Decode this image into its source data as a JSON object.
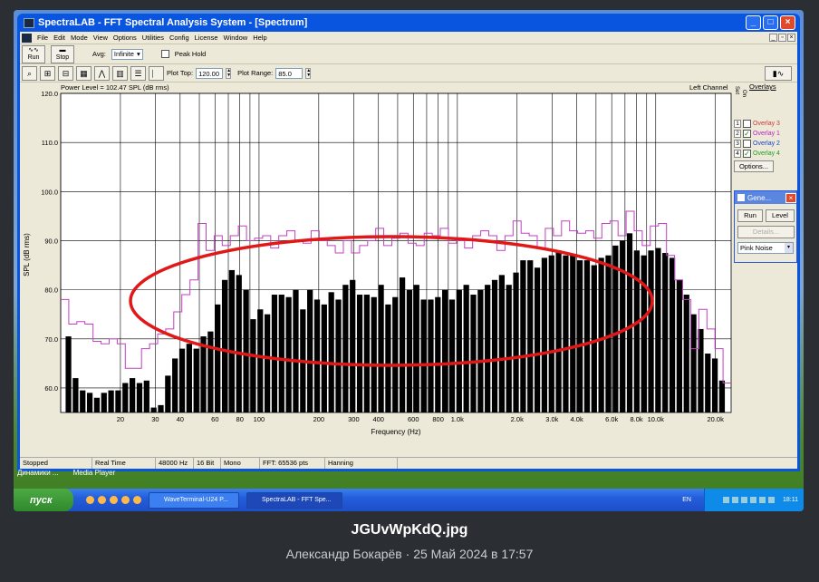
{
  "window": {
    "title": "SpectraLAB - FFT Spectral Analysis System - [Spectrum]"
  },
  "menu": [
    "File",
    "Edit",
    "Mode",
    "View",
    "Options",
    "Utilities",
    "Config",
    "License",
    "Window",
    "Help"
  ],
  "toolbar": {
    "run_label": "Run",
    "stop_label": "Stop",
    "avg_label": "Avg:",
    "avg_value": "Infinite",
    "peak_hold_label": "Peak Hold",
    "plot_top_label": "Plot Top:",
    "plot_top_value": "120.00",
    "plot_range_label": "Plot Range:",
    "plot_range_value": "85.0"
  },
  "plot": {
    "power_level": "Power Level = 102.47 SPL (dB rms)",
    "channel": "Left Channel"
  },
  "overlays": {
    "title": "Overlays",
    "set_label": "Set",
    "on_label": "On",
    "items": [
      {
        "num": "1",
        "label": "Overlay 3",
        "checked": false,
        "color": "#c83a3a"
      },
      {
        "num": "2",
        "label": "Overlay 1",
        "checked": true,
        "color": "#c020c0"
      },
      {
        "num": "3",
        "label": "Overlay 2",
        "checked": false,
        "color": "#2040c0"
      },
      {
        "num": "4",
        "label": "Overlay 4",
        "checked": true,
        "color": "#20a020"
      }
    ],
    "options_label": "Options..."
  },
  "generator": {
    "title": "Gene...",
    "run_label": "Run",
    "level_label": "Level",
    "details_label": "Details...",
    "signal": "Pink Noise"
  },
  "status": [
    "Stopped",
    "Real Time",
    "48000 Hz",
    "16 Bit",
    "Mono",
    "FFT: 65536 pts",
    "Hanning"
  ],
  "desktop": {
    "icon_labels": [
      "Динамики ...",
      "Media Player"
    ]
  },
  "taskbar": {
    "start_label": "пуск",
    "tasks": [
      "WaveTerminal-U24 P...",
      "SpectraLAB - FFT Spe..."
    ],
    "lang": "EN",
    "time": "18:11"
  },
  "caption": {
    "filename": "JGUvWpKdQ.jpg",
    "meta": "Александр Бокарёв · 25 Май 2024 в 17:57"
  },
  "chart_data": {
    "type": "bar",
    "title": "",
    "xlabel": "Frequency (Hz)",
    "ylabel": "SPL (dB rms)",
    "ylim": [
      55,
      120
    ],
    "x_scale": "log",
    "xlim": [
      10,
      24000
    ],
    "y_ticks": [
      "120.0",
      "110.0",
      "100.0",
      "90.0",
      "80.0",
      "70.0",
      "60.0"
    ],
    "x_tick_labels": [
      {
        "f": 20,
        "label": "20"
      },
      {
        "f": 30,
        "label": "30"
      },
      {
        "f": 40,
        "label": "40"
      },
      {
        "f": 60,
        "label": "60"
      },
      {
        "f": 80,
        "label": "80"
      },
      {
        "f": 100,
        "label": "100"
      },
      {
        "f": 200,
        "label": "200"
      },
      {
        "f": 300,
        "label": "300"
      },
      {
        "f": 400,
        "label": "400"
      },
      {
        "f": 600,
        "label": "600"
      },
      {
        "f": 800,
        "label": "800"
      },
      {
        "f": 1000,
        "label": "1.0k"
      },
      {
        "f": 2000,
        "label": "2.0k"
      },
      {
        "f": 3000,
        "label": "3.0k"
      },
      {
        "f": 4000,
        "label": "4.0k"
      },
      {
        "f": 6000,
        "label": "6.0k"
      },
      {
        "f": 8000,
        "label": "8.0k"
      },
      {
        "f": 10000,
        "label": "10.0k"
      },
      {
        "f": 20000,
        "label": "20.0k"
      }
    ],
    "grid": true,
    "bar_color": "#000000",
    "overlay_color": "#c040c0",
    "annotation_color": "#e01818",
    "series": [
      {
        "values": [
          70.5,
          62,
          59.5,
          59,
          58,
          59,
          59.5,
          59.5,
          61,
          62,
          61,
          61.5,
          56,
          56.5,
          62.5,
          66,
          68,
          69,
          68,
          70.5,
          71.5,
          77,
          82,
          84,
          83,
          80,
          74,
          76,
          75,
          79,
          79,
          78.5,
          80,
          76,
          80,
          78,
          77,
          79.5,
          78,
          81,
          82,
          79,
          79,
          78.5,
          81,
          77,
          78.5,
          82.5,
          80,
          81,
          78,
          78,
          78.5,
          80,
          78,
          80,
          81,
          79,
          80,
          81,
          82,
          83,
          81,
          83.5,
          86,
          86,
          84.5,
          86.5,
          87,
          88,
          87,
          87,
          86,
          86,
          85,
          86.5,
          87,
          89,
          90,
          91.5,
          88,
          87,
          88,
          88.5,
          87.5,
          86.5,
          82,
          79,
          75,
          72,
          67,
          66,
          61.5
        ]
      }
    ],
    "overlay": {
      "values": [
        78,
        73,
        73.5,
        73,
        69.5,
        69,
        70,
        69,
        64,
        64,
        68,
        69,
        71,
        72,
        75.5,
        79,
        82,
        93.5,
        88,
        91,
        89,
        91,
        93,
        90,
        90.5,
        91,
        88.5,
        91,
        92,
        90,
        89.5,
        92,
        90,
        89,
        87.5,
        90,
        87.5,
        89,
        90,
        92.5,
        89,
        90.5,
        91.5,
        89.5,
        89,
        91.5,
        91,
        92.5,
        89.5,
        90,
        88.5,
        91,
        92,
        91,
        88,
        91,
        94,
        91.5,
        91,
        88.5,
        92.5,
        91,
        94,
        92,
        91.5,
        92,
        90.5,
        93.5,
        94,
        91,
        96,
        92,
        89,
        93,
        93.5,
        87,
        82,
        78,
        68,
        76,
        72,
        68,
        61
      ]
    }
  }
}
